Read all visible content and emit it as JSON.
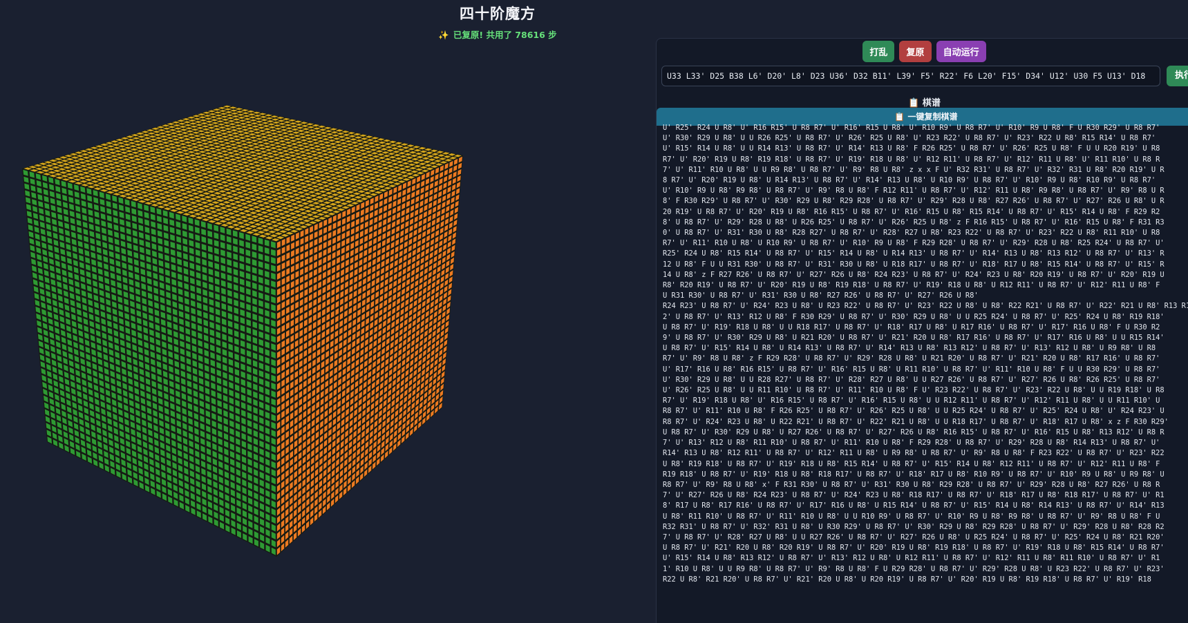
{
  "header": {
    "title": "四十阶魔方",
    "status": "已复原! 共用了 78616 步"
  },
  "cube": {
    "order": 40,
    "faces": {
      "top": "#d4a51c",
      "front": "#2e9a33",
      "right": "#ec7a21",
      "gap": "#161a14"
    }
  },
  "controls": {
    "scramble_label": "打乱",
    "reset_label": "复原",
    "autorun_label": "自动运行",
    "execute_label": "执行",
    "alg_value": "U33 L33' D25 B38 L6' D20' L8' D23 U36' D32 B11' L39' F5' R22' F6 L20' F15' D34' U12' U30 F5 U13' D18",
    "copy_label": "一键复制棋谱"
  },
  "record": {
    "label": "棋谱",
    "lines": [
      "U' R25' R24 U R8' U' R16 R15' U R8 R7' U' R16' R15 U R8' U' R10 R9' U R8 R7' U' R10' R9 U R8' F U R30 R29' U R8 R7'",
      "U' R30' R29 U R8' U U R26 R25' U R8 R7' U' R26' R25 U R8' U' R23 R22' U R8 R7' U' R23' R22 U R8' R15 R14' U R8 R7'",
      "U' R15' R14 U R8' U U R14 R13' U R8 R7' U' R14' R13 U R8' F R26 R25' U R8 R7' U' R26' R25 U R8' F U U R20 R19' U R8",
      "R7' U' R20' R19 U R8' R19 R18' U R8 R7' U' R19' R18 U R8' U' R12 R11' U R8 R7' U' R12' R11 U R8' U' R11 R10' U R8 R",
      "7' U' R11' R10 U R8' U U R9 R8' U R8 R7' U' R9' R8 U R8' z x x F U' R32 R31' U R8 R7' U' R32' R31 U R8' R20 R19' U R",
      "8 R7' U' R20' R19 U R8' U R14 R13' U R8 R7' U' R14' R13 U R8' U R10 R9' U R8 R7' U' R10' R9 U R8' R10 R9' U R8 R7'",
      "U' R10' R9 U R8' R9 R8' U R8 R7' U' R9' R8 U R8' F R12 R11' U R8 R7' U' R12' R11 U R8' R9 R8' U R8 R7' U' R9' R8 U R",
      "8' F R30 R29' U R8 R7' U' R30' R29 U R8' R29 R28' U R8 R7' U' R29' R28 U R8' R27 R26' U R8 R7' U' R27' R26 U R8' U R",
      "20 R19' U R8 R7' U' R20' R19 U R8' R16 R15' U R8 R7' U' R16' R15 U R8' R15 R14' U R8 R7' U' R15' R14 U R8' F R29 R2",
      "8' U R8 R7' U' R29' R28 U R8' U R26 R25' U R8 R7' U' R26' R25 U R8' z F R16 R15' U R8 R7' U' R16' R15 U R8' F R31 R3",
      "0' U R8 R7' U' R31' R30 U R8' R28 R27' U R8 R7' U' R28' R27 U R8' R23 R22' U R8 R7' U' R23' R22 U R8' R11 R10' U R8",
      "R7' U' R11' R10 U R8' U R10 R9' U R8 R7' U' R10' R9 U R8' F R29 R28' U R8 R7' U' R29' R28 U R8' R25 R24' U R8 R7' U'",
      "R25' R24 U R8' R15 R14' U R8 R7' U' R15' R14 U R8' U R14 R13' U R8 R7' U' R14' R13 U R8' R13 R12' U R8 R7' U' R13' R",
      "12 U R8' F U U R31 R30' U R8 R7' U' R31' R30 U R8' U R18 R17' U R8 R7' U' R18' R17 U R8' R15 R14' U R8 R7' U' R15' R",
      "14 U R8' z F R27 R26' U R8 R7' U' R27' R26 U R8' R24 R23' U R8 R7' U' R24' R23 U R8' R20 R19' U R8 R7' U' R20' R19 U",
      "R8' R20 R19' U R8 R7' U' R20' R19 U R8' R19 R18' U R8 R7' U' R19' R18 U R8' U R12 R11' U R8 R7' U' R12' R11 U R8' F",
      "U R31 R30' U R8 R7' U' R31' R30 U R8' R27 R26' U R8 R7' U' R27' R26 U R8'",
      "R24 R23' U R8 R7' U' R24' R23 U R8' U R23 R22' U R8 R7' U' R23' R22 U R8' U R8' R22 R21' U R8 R7' U' R22' R21 U R8' R13 R1",
      "2' U R8 R7' U' R13' R12 U R8' F R30 R29' U R8 R7' U' R30' R29 U R8' U U R25 R24' U R8 R7' U' R25' R24 U R8' R19 R18'",
      "U R8 R7' U' R19' R18 U R8' U U R18 R17' U R8 R7' U' R18' R17 U R8' U R17 R16' U R8 R7' U' R17' R16 U R8' F U R30 R2",
      "9' U R8 R7' U' R30' R29 U R8' U R21 R20' U R8 R7' U' R21' R20 U R8' R17 R16' U R8 R7' U' R17' R16 U R8' U U R15 R14'",
      "U R8 R7' U' R15' R14 U R8' U R14 R13' U R8 R7' U' R14' R13 U R8' R13 R12' U R8 R7' U' R13' R12 U R8' U R9 R8' U R8",
      "R7' U' R9' R8 U R8' z F R29 R28' U R8 R7' U' R29' R28 U R8' U R21 R20' U R8 R7' U' R21' R20 U R8' R17 R16' U R8 R7'",
      "U' R17' R16 U R8' R16 R15' U R8 R7' U' R16' R15 U R8' U R11 R10' U R8 R7' U' R11' R10 U R8' F U U R30 R29' U R8 R7'",
      "U' R30' R29 U R8' U U R28 R27' U R8 R7' U' R28' R27 U R8' U U R27 R26' U R8 R7' U' R27' R26 U R8' R26 R25' U R8 R7'",
      "U' R26' R25 U R8' U U R11 R10' U R8 R7' U' R11' R10 U R8' F U' R23 R22' U R8 R7' U' R23' R22 U R8' U U R19 R18' U R8",
      "R7' U' R19' R18 U R8' U' R16 R15' U R8 R7' U' R16' R15 U R8' U U R12 R11' U R8 R7' U' R12' R11 U R8' U U R11 R10' U",
      "R8 R7' U' R11' R10 U R8' F R26 R25' U R8 R7' U' R26' R25 U R8' U U R25 R24' U R8 R7' U' R25' R24 U R8' U' R24 R23' U",
      "R8 R7' U' R24' R23 U R8' U R22 R21' U R8 R7' U' R22' R21 U R8' U U R18 R17' U R8 R7' U' R18' R17 U R8' x z F R30 R29'",
      "U R8 R7' U' R30' R29 U R8' U R27 R26' U R8 R7' U' R27' R26 U R8' R16 R15' U R8 R7' U' R16' R15 U R8' R13 R12' U R8 R",
      "7' U' R13' R12 U R8' R11 R10' U R8 R7' U' R11' R10 U R8' F R29 R28' U R8 R7' U' R29' R28 U R8' R14 R13' U R8 R7' U'",
      "R14' R13 U R8' R12 R11' U R8 R7' U' R12' R11 U R8' U R9 R8' U R8 R7' U' R9' R8 U R8' F R23 R22' U R8 R7' U' R23' R22",
      "U R8' R19 R18' U R8 R7' U' R19' R18 U R8' R15 R14' U R8 R7' U' R15' R14 U R8' R12 R11' U R8 R7' U' R12' R11 U R8' F",
      "R19 R18' U R8 R7' U' R19' R18 U R8' R18 R17' U R8 R7' U' R18' R17 U R8' R10 R9' U R8 R7' U' R10' R9 U R8' U R9 R8' U",
      "R8 R7' U' R9' R8 U R8' x' F R31 R30' U R8 R7' U' R31' R30 U R8' R29 R28' U R8 R7' U' R29' R28 U R8' R27 R26' U R8 R",
      "7' U' R27' R26 U R8' R24 R23' U R8 R7' U' R24' R23 U R8' R18 R17' U R8 R7' U' R18' R17 U R8' R18 R17' U R8 R7' U' R1",
      "8' R17 U R8' R17 R16' U R8 R7' U' R17' R16 U R8' U R15 R14' U R8 R7' U' R15' R14 U R8' R14 R13' U R8 R7' U' R14' R13",
      "U R8' R11 R10' U R8 R7' U' R11' R10 U R8' U U R10 R9' U R8 R7' U' R10' R9 U R8' R9 R8' U R8 R7' U' R9' R8 U R8' F U",
      "R32 R31' U R8 R7' U' R32' R31 U R8' U R30 R29' U R8 R7' U' R30' R29 U R8' R29 R28' U R8 R7' U' R29' R28 U R8' R28 R2",
      "7' U R8 R7' U' R28' R27 U R8' U U R27 R26' U R8 R7' U' R27' R26 U R8' U R25 R24' U R8 R7' U' R25' R24 U R8' R21 R20'",
      "U R8 R7' U' R21' R20 U R8' R20 R19' U R8 R7' U' R20' R19 U R8' R19 R18' U R8 R7' U' R19' R18 U R8' R15 R14' U R8 R7'",
      "U' R15' R14 U R8' R13 R12' U R8 R7' U' R13' R12 U R8' U R12 R11' U R8 R7' U' R12' R11 U R8' R11 R10' U R8 R7' U' R1",
      "1' R10 U R8' U U R9 R8' U R8 R7' U' R9' R8 U R8' F U R29 R28' U R8 R7' U' R29' R28 U R8' U R23 R22' U R8 R7' U' R23'",
      "R22 U R8' R21 R20' U R8 R7' U' R21' R20 U R8' U R20 R19' U R8 R7' U' R20' R19 U R8' R19 R18' U R8 R7' U' R19' R18"
    ]
  }
}
